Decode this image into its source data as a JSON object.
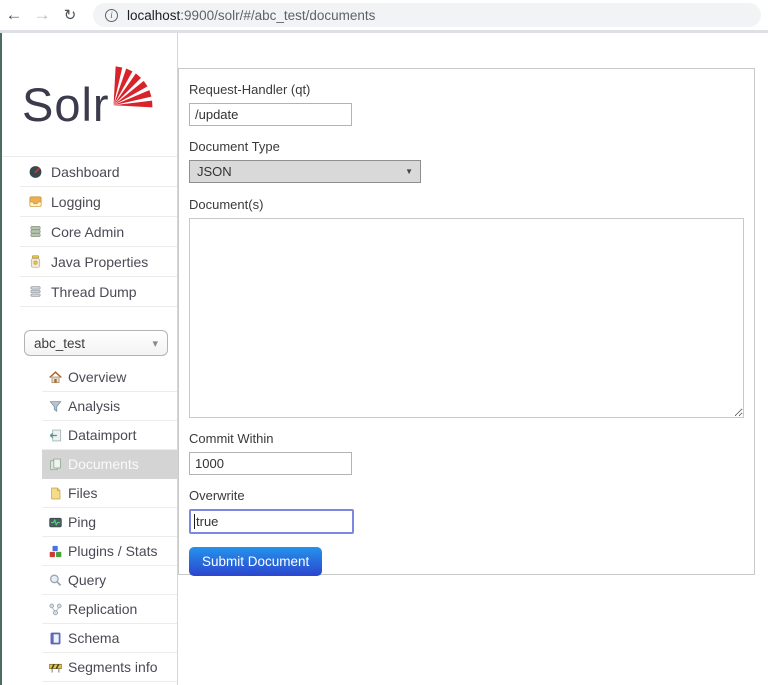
{
  "browser": {
    "back_icon": "←",
    "forward_icon": "→",
    "refresh_icon": "↻",
    "info_icon": "i",
    "url_host": "localhost",
    "url_rest": ":9900/solr/#/abc_test/documents"
  },
  "sidebar": {
    "logo_text": "Solr",
    "nav": [
      {
        "label": "Dashboard"
      },
      {
        "label": "Logging"
      },
      {
        "label": "Core Admin"
      },
      {
        "label": "Java Properties"
      },
      {
        "label": "Thread Dump"
      }
    ],
    "core_selector": {
      "value": "abc_test",
      "caret": "▾"
    },
    "core_nav": [
      {
        "label": "Overview"
      },
      {
        "label": "Analysis"
      },
      {
        "label": "Dataimport"
      },
      {
        "label": "Documents",
        "active": true
      },
      {
        "label": "Files"
      },
      {
        "label": "Ping"
      },
      {
        "label": "Plugins / Stats"
      },
      {
        "label": "Query"
      },
      {
        "label": "Replication"
      },
      {
        "label": "Schema"
      },
      {
        "label": "Segments info"
      }
    ]
  },
  "form": {
    "request_handler": {
      "label": "Request-Handler (qt)",
      "value": "/update"
    },
    "document_type": {
      "label": "Document Type",
      "value": "JSON",
      "caret": "▼"
    },
    "documents": {
      "label": "Document(s)",
      "value": ""
    },
    "commit_within": {
      "label": "Commit Within",
      "value": "1000"
    },
    "overwrite": {
      "label": "Overwrite",
      "value": "true"
    },
    "submit_label": "Submit Document"
  },
  "colors": {
    "logo_red": "#d8232a",
    "button_gradient_top": "#2493ec",
    "button_gradient_bottom": "#2b45cf",
    "focus_border": "#7b87e3",
    "selected_row_bg": "#d4d4d4",
    "url_pill_bg": "#f1f3f4",
    "select_bg": "#d9d9d9"
  }
}
